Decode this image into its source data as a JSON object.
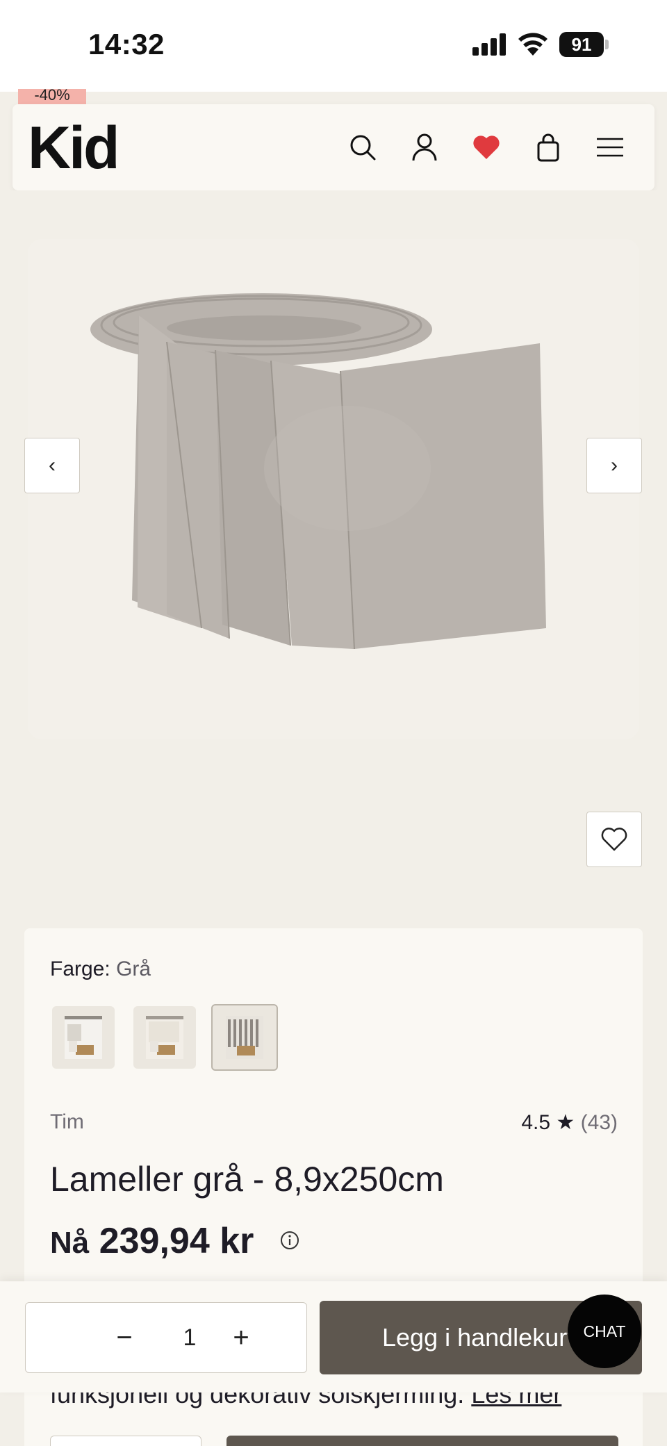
{
  "status_bar": {
    "time": "14:32",
    "battery": "91"
  },
  "discount_tag": "-40%",
  "header": {
    "logo": "Kid",
    "icons": [
      "search-icon",
      "account-icon",
      "heart-icon",
      "bag-icon",
      "menu-icon"
    ],
    "heart_color": "#e03a3e"
  },
  "gallery": {
    "prev_label": "‹",
    "next_label": "›"
  },
  "product": {
    "color_label": "Farge:",
    "color_value": "Grå",
    "swatch_count": 3,
    "selected_swatch": 3,
    "brand": "Tim",
    "rating": "4.5",
    "star": "★",
    "review_count": "(43)",
    "title": "Lameller grå - 8,9x250cm",
    "price_prefix": "Nå",
    "price": "239,94 kr"
  },
  "description": {
    "text": "funksjonell og dekorativ solskjerming.",
    "read_more": "Les mer"
  },
  "sticky_bar": {
    "quantity": "1",
    "minus": "−",
    "plus": "+",
    "add_to_cart": "Legg i handlekurv",
    "chat": "CHAT"
  },
  "colors": {
    "background": "#f2efe8",
    "card": "#faf8f3",
    "button_dark": "#5e574f",
    "fabric": "#b9b3ad"
  }
}
